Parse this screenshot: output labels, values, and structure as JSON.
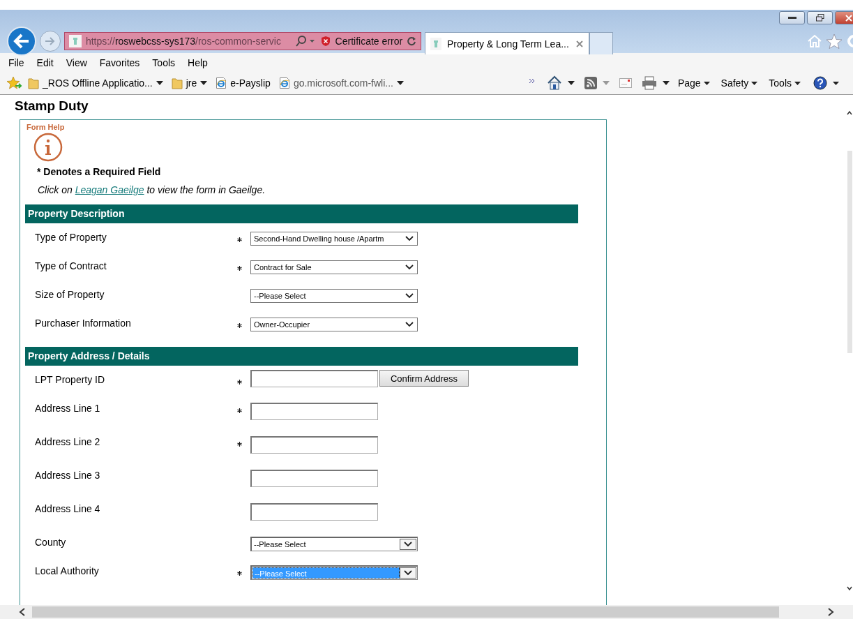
{
  "browser": {
    "address": {
      "scheme": "https://",
      "host": "roswebcss-sys173",
      "path": "/ros-common-servic"
    },
    "certificate_error": "Certificate error",
    "tabs": [
      {
        "title": "Property & Long Term Lea...",
        "selected": true
      }
    ],
    "menu": [
      "File",
      "Edit",
      "View",
      "Favorites",
      "Tools",
      "Help"
    ],
    "favorites": [
      {
        "kind": "folder",
        "label": "_ROS Offline Applicatio...",
        "dropdown": true
      },
      {
        "kind": "folder",
        "label": "jre",
        "dropdown": true
      },
      {
        "kind": "page",
        "label": "e-Payslip",
        "dropdown": false
      },
      {
        "kind": "page",
        "label": "go.microsoft.com-fwli...",
        "dropdown": true
      }
    ],
    "commands": [
      "Page",
      "Safety",
      "Tools"
    ]
  },
  "page": {
    "title": "Stamp Duty",
    "form_help": "Form Help",
    "required_note": "* Denotes a Required Field",
    "gaeilge_note": {
      "before": "Click on",
      "link": "Leagan Gaeilge",
      "after": "to view the form in Gaeilge."
    },
    "sections": [
      {
        "title": "Property Description",
        "fields": [
          {
            "label": "Type of Property",
            "required": true,
            "kind": "select",
            "value": "Second-Hand Dwelling house /Apartm"
          },
          {
            "label": "Type of Contract",
            "required": true,
            "kind": "select",
            "value": "Contract for Sale"
          },
          {
            "label": "Size of Property",
            "required": false,
            "kind": "select",
            "value": "--Please Select"
          },
          {
            "label": "Purchaser Information",
            "required": true,
            "kind": "select",
            "value": "Owner-Occupier"
          }
        ]
      },
      {
        "title": "Property Address / Details",
        "fields": [
          {
            "label": "LPT Property ID",
            "required": true,
            "kind": "text",
            "button": "Confirm Address"
          },
          {
            "label": "Address Line 1",
            "required": true,
            "kind": "text"
          },
          {
            "label": "Address Line 2",
            "required": true,
            "kind": "text"
          },
          {
            "label": "Address Line 3",
            "required": false,
            "kind": "text"
          },
          {
            "label": "Address Line 4",
            "required": false,
            "kind": "text"
          },
          {
            "label": "County",
            "required": false,
            "kind": "combo",
            "value": "--Please Select",
            "focused": false
          },
          {
            "label": "Local Authority",
            "required": true,
            "kind": "combo",
            "value": "--Please Select",
            "focused": true
          }
        ]
      }
    ]
  }
}
